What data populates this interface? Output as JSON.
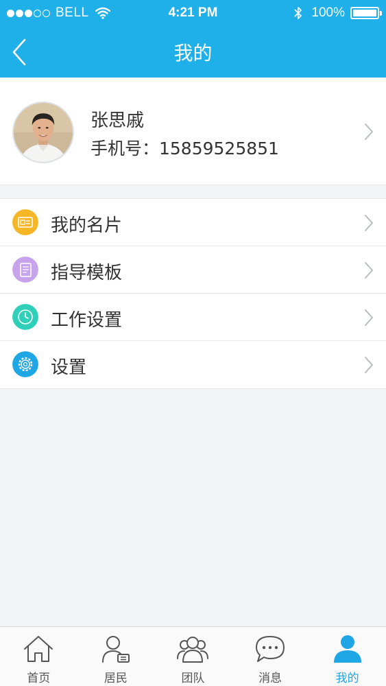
{
  "status_bar": {
    "carrier": "BELL",
    "time": "4:21 PM",
    "battery": "100%",
    "signal_bars": 3,
    "signal_max": 5
  },
  "navbar": {
    "title": "我的"
  },
  "profile": {
    "name": "张思戚",
    "phone": "手机号：15859525851"
  },
  "menu": [
    {
      "label": "我的名片",
      "icon": "business-card-icon",
      "color": "#f6b626"
    },
    {
      "label": "指导模板",
      "icon": "document-template-icon",
      "color": "#c7a3eb"
    },
    {
      "label": "工作设置",
      "icon": "clock-icon",
      "color": "#2fd0b9"
    },
    {
      "label": "设置",
      "icon": "gear-icon",
      "color": "#1fa6e4"
    }
  ],
  "tabbar": {
    "active": "我的",
    "active_color": "#1fa6e4",
    "items": [
      {
        "label": "首页",
        "icon": "home-icon"
      },
      {
        "label": "居民",
        "icon": "resident-icon"
      },
      {
        "label": "团队",
        "icon": "team-icon"
      },
      {
        "label": "消息",
        "icon": "message-icon"
      },
      {
        "label": "我的",
        "icon": "person-icon"
      }
    ]
  },
  "colors": {
    "header": "#1fb0ea",
    "background": "#f2f3f5"
  }
}
